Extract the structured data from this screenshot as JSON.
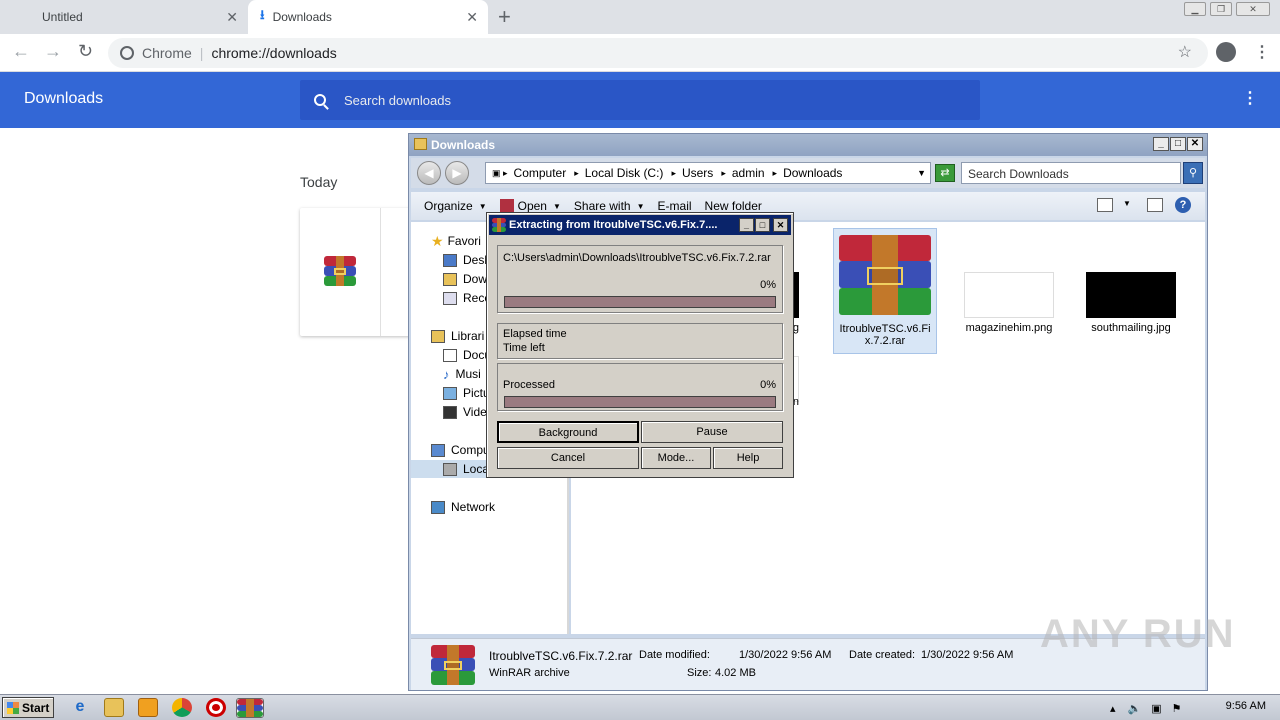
{
  "browser": {
    "tabs": [
      {
        "label": "Untitled",
        "close": "✕"
      },
      {
        "label": "Downloads",
        "close": "✕"
      }
    ],
    "new_tab": "+",
    "omnibox": {
      "site_label": "Chrome",
      "separator": "|",
      "url": "chrome://downloads"
    }
  },
  "downloads_page": {
    "title": "Downloads",
    "search_placeholder": "Search downloads",
    "section": "Today"
  },
  "explorer": {
    "title": "Downloads",
    "breadcrumbs": [
      "Computer",
      "Local Disk (C:)",
      "Users",
      "admin",
      "Downloads"
    ],
    "search_placeholder": "Search Downloads",
    "toolbar": [
      "Organize",
      "Open",
      "Share with",
      "E-mail",
      "New folder"
    ],
    "nav": {
      "favorites": [
        "Favori",
        "Desk",
        "Dow",
        "Rece"
      ],
      "libraries": [
        "Librari",
        "Docu",
        "Musi",
        "Pictu",
        "Vide"
      ],
      "computer": [
        "Compu",
        "Loca"
      ],
      "network": "Network"
    },
    "files": [
      {
        "name": "og"
      },
      {
        "name": "ItroublveTSC.v6.Fix.7.2.rar"
      },
      {
        "name": "magazinehim.png"
      },
      {
        "name": "southmailing.jpg"
      },
      {
        "name": "pn"
      }
    ],
    "details": {
      "file_name": "ItroublveTSC.v6.Fix.7.2.rar",
      "type": "WinRAR archive",
      "modified_label": "Date modified:",
      "modified_value": "1/30/2022 9:56 AM",
      "size_label": "Size:",
      "size_value": "4.02 MB",
      "created_label": "Date created:",
      "created_value": "1/30/2022 9:56 AM"
    }
  },
  "winrar_dialog": {
    "title": "Extracting from ItroublveTSC.v6.Fix.7....",
    "path": "C:\\Users\\admin\\Downloads\\ItroublveTSC.v6.Fix.7.2.rar",
    "file_percent": "0%",
    "file_progress": 0,
    "elapsed_label": "Elapsed time",
    "time_left_label": "Time left",
    "processed_label": "Processed",
    "processed_percent": "0%",
    "processed_progress": 0,
    "buttons": {
      "background": "Background",
      "pause": "Pause",
      "cancel": "Cancel",
      "mode": "Mode...",
      "help": "Help"
    }
  },
  "taskbar": {
    "start": "Start",
    "clock": "9:56 AM"
  },
  "watermark": "ANY RUN",
  "colors": {
    "chrome_header": "#3367d6",
    "search_bg": "#2a56c6",
    "rar_title": "#0a246a",
    "progress_track": "#9a7a80"
  }
}
